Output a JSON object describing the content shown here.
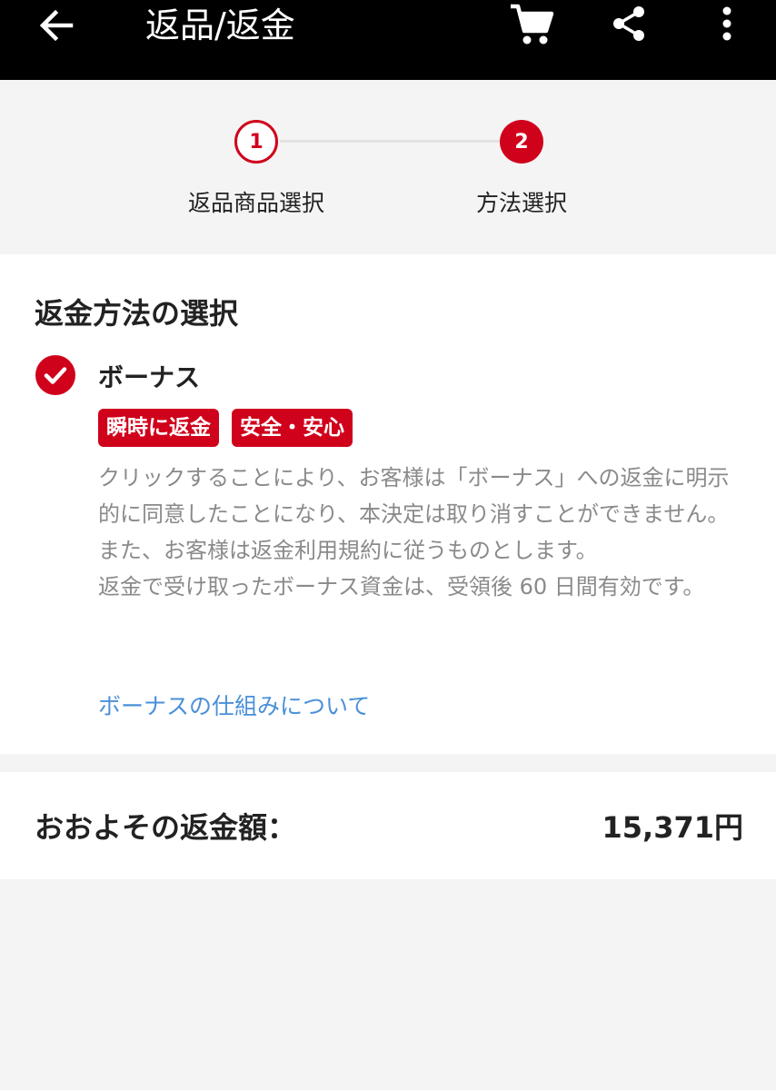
{
  "header": {
    "title": "返品/返金"
  },
  "icons": {
    "back": "arrow-left-icon",
    "cart": "cart-icon",
    "share": "share-icon",
    "more": "more-vertical-icon"
  },
  "stepper": {
    "steps": [
      {
        "number": "1",
        "label": "返品商品選択"
      },
      {
        "number": "2",
        "label": "方法選択"
      }
    ]
  },
  "refund_method": {
    "heading": "返金方法の選択",
    "option": "ボーナス",
    "badges": [
      "瞬時に返金",
      "安全・安心"
    ],
    "description": [
      "クリックすることにより、お客様は「ボーナス」への返金に明示的に同意したことになり、本決定は取り消すことができません。また、お客様は返金利用規約に従うものとします。",
      "返金で受け取ったボーナス資金は、受領後 60 日間有効です。"
    ],
    "link": "ボーナスの仕組みについて"
  },
  "refund": {
    "label": "おおよその返金額：",
    "amount": "15,371円"
  },
  "colors": {
    "accent": "#d0021b",
    "link": "#4a90d9"
  }
}
